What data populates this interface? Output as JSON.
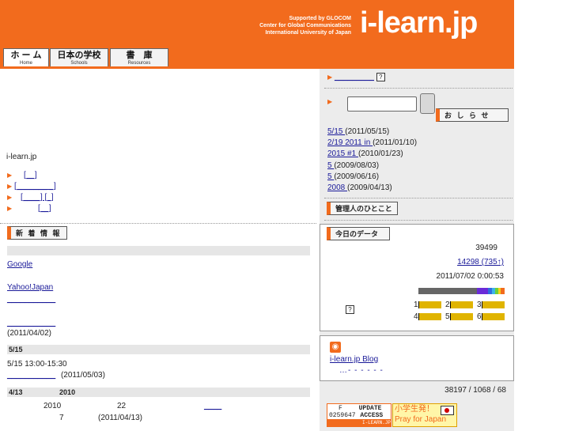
{
  "header": {
    "support_lines": [
      "Supported by GLOCOM",
      "Center for Global Communications",
      "International University of Japan"
    ],
    "logo": "i-learn.jp"
  },
  "tabs": [
    {
      "jp": "ホ ー ム",
      "en": "Home"
    },
    {
      "jp": "日本の学校",
      "en": "Schools"
    },
    {
      "jp": "書　庫",
      "en": "Resources"
    }
  ],
  "left": {
    "site_name": "i-learn.jp",
    "nav_links": [
      {
        "text": "[__]"
      },
      {
        "text": "[_______  _]"
      },
      {
        "text": "[____] [_]"
      },
      {
        "text": "[__]"
      }
    ],
    "news_header": "新 着 情 報",
    "links": [
      "Google",
      "Yahoo!Japan",
      "___________",
      "___________"
    ],
    "date1": "(2011/04/02)",
    "row_515": "5/15",
    "event_time": "5/15 13:00-15:30",
    "date2": "(2011/05/03)",
    "row_413": "4/13",
    "row_413_year": "2010",
    "year_2010": "2010",
    "num_22": "22",
    "num_7": "7",
    "date3": "(2011/04/13)"
  },
  "right": {
    "search_button": "",
    "notice_header": "お し ら せ",
    "notices": [
      {
        "link": "5/15          ",
        "date": "(2011/05/15)"
      },
      {
        "link": "2/19      2011    in ",
        "date": "(2011/01/10)"
      },
      {
        "link": "    2015    #1          ",
        "date": "(2010/01/23)"
      },
      {
        "link": "5         ",
        "date": "(2009/08/03)"
      },
      {
        "link": "5        ",
        "date": "(2009/06/16)"
      },
      {
        "link": "2008        ",
        "date": "(2009/04/13)"
      }
    ],
    "admin_header": "管理人のひとこと",
    "today_header": "今日のデータ",
    "count1": "39499",
    "count2": "14298 (735↑)",
    "timestamp": "2011/07/02 0:00:53",
    "coins": [
      {
        "label": "1"
      },
      {
        "label": "2"
      },
      {
        "label": "3"
      },
      {
        "label": "4"
      },
      {
        "label": "5"
      },
      {
        "label": "6"
      }
    ],
    "rss_link": "i-learn.jp      Blog",
    "stats": "38197 / 1068 / 68",
    "banner_counter_label": "F",
    "banner_counter_value": "0259647",
    "banner_update": "UPDATE",
    "banner_access": "ACCESS",
    "banner_site": "I-LEARN.JP",
    "banner2_top": "小学生発！",
    "banner2_bottom": "Pray for Japan"
  }
}
